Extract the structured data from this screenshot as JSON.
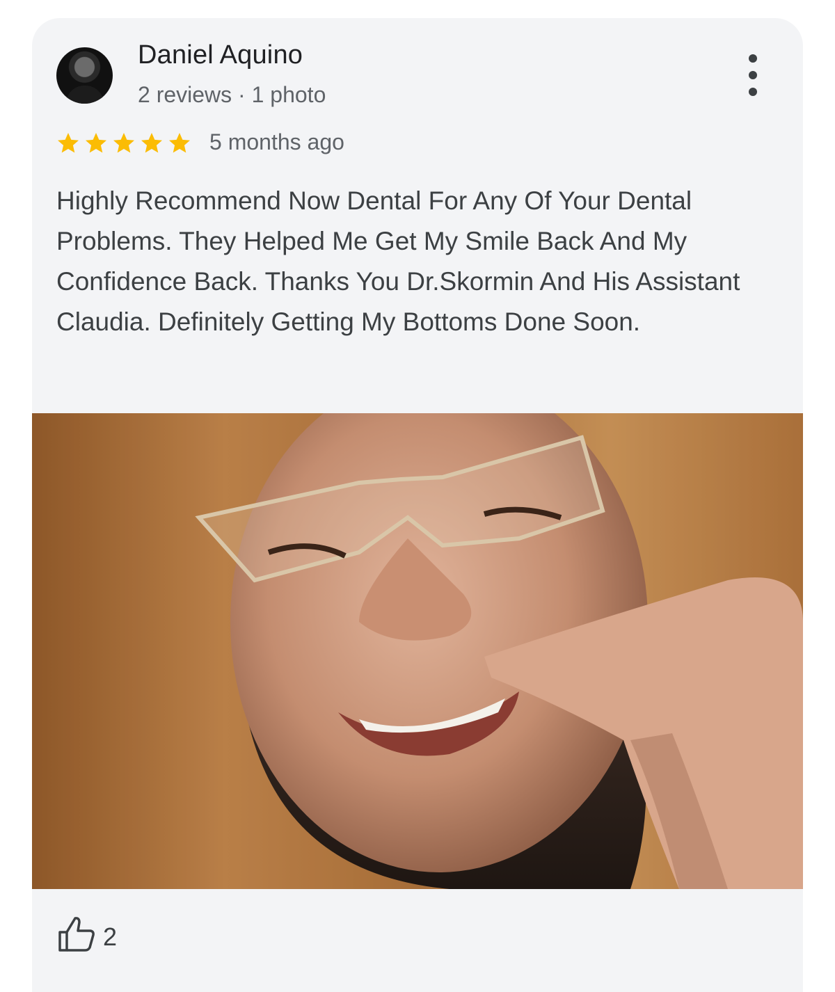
{
  "review": {
    "reviewer_name": "Daniel Aquino",
    "reviewer_meta": "2 reviews · 1 photo",
    "rating": 5,
    "rating_max": 5,
    "time_ago": "5 months ago",
    "text": "Highly Recommend Now Dental For Any Of Your Dental Problems. They Helped Me Get My Smile Back And My Confidence Back. Thanks You Dr.Skormin And His Assistant Claudia. Definitely Getting My Bottoms Done Soon.",
    "like_count": "2"
  },
  "icons": {
    "more": "more-vert-icon",
    "star": "star-icon",
    "like": "thumbs-up-icon"
  },
  "colors": {
    "card_background": "#f3f4f6",
    "star": "#fbbc04",
    "text_primary": "#202124",
    "text_secondary": "#5f6368"
  }
}
